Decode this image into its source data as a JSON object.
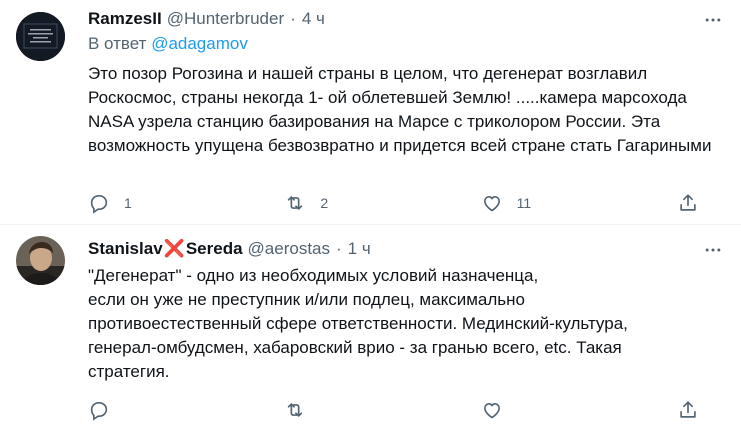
{
  "tweets": [
    {
      "name": "RamzesII",
      "handle": "@Hunterbruder",
      "dot": "·",
      "time": "4 ч",
      "reply_prefix": "В ответ",
      "reply_to": "@adagamov",
      "text": "Это позор Рогозина и нашей страны в целом, что дегенерат возглавил Роскосмос, страны некогда 1- ой облетевшей Землю! .....камера марсохода NASA узрела станцию базирования  на Марсе с триколором России. Эта возможность упущена безвозвратно и придется всей стране стать Гагариными",
      "replies": "1",
      "retweets": "2",
      "likes": "11",
      "avatar_text": "не нужно\nдеградировать\nкак все\nостальные"
    },
    {
      "name_first": "Stanislav",
      "name_cross": "❌",
      "name_last": "Sereda",
      "handle": "@aerostas",
      "dot": "·",
      "time": "1 ч",
      "text": "\"Дегенерат\" - одно из необходимых условий назначенца,\nесли он уже не преступник и/или подлец, максимально\nпротивоестественный сфере ответственности.  Мединский-культура,\nгенерал-омбудсмен,  хабаровский врио - за гранью всего, etc. Такая\nстратегия.",
      "replies": "",
      "retweets": "",
      "likes": ""
    }
  ],
  "icons": {
    "more": "more-horizontal-icon",
    "reply": "reply-bubble-icon",
    "retweet": "retweet-icon",
    "like": "heart-icon",
    "share": "share-icon"
  }
}
